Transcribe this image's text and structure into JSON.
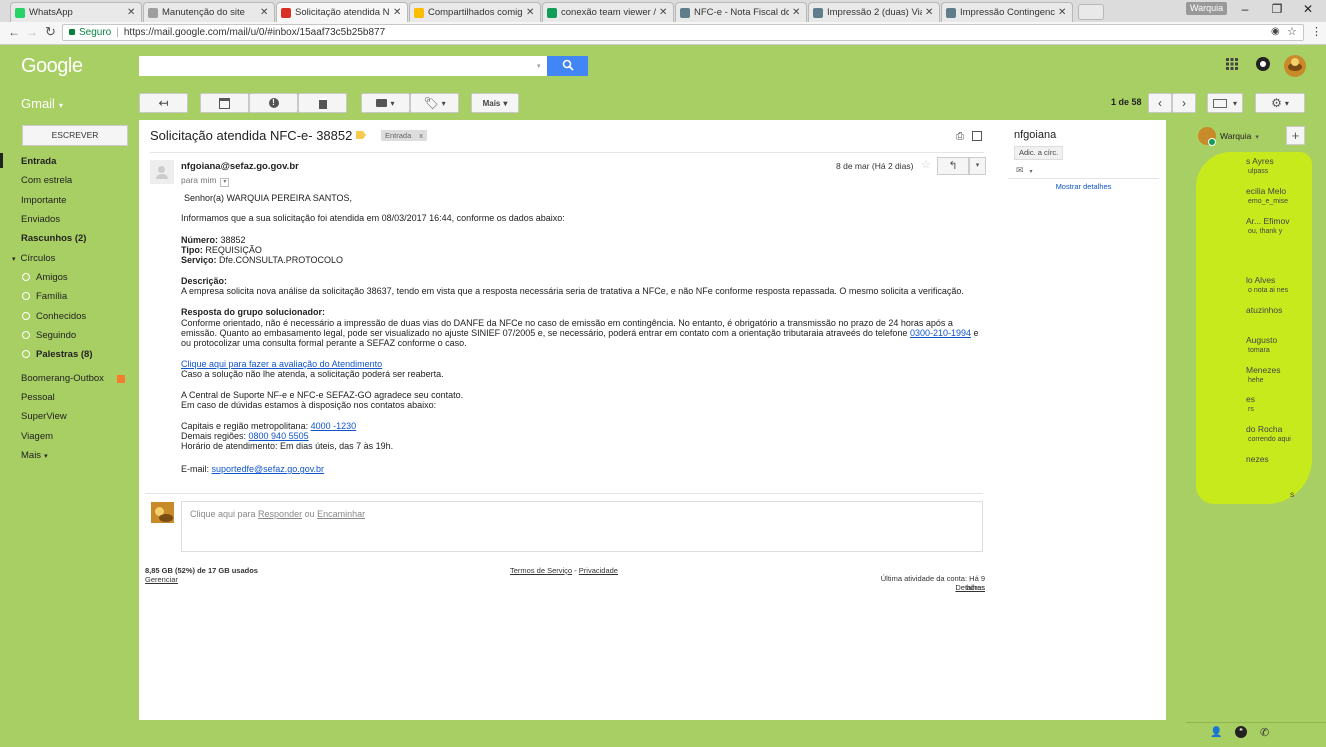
{
  "browser": {
    "tabs": [
      {
        "title": "WhatsApp",
        "icon": "whatsapp-icon",
        "color": "#25d366"
      },
      {
        "title": "Manutenção do site",
        "icon": "page-icon",
        "color": "#9e9e9e"
      },
      {
        "title": "Solicitação atendida NFC",
        "icon": "gmail-icon",
        "color": "#d93025",
        "active": true
      },
      {
        "title": "Compartilhados comigo",
        "icon": "drive-icon",
        "color": "#fbbc04"
      },
      {
        "title": "conexão team viewer / c",
        "icon": "sheets-icon",
        "color": "#0f9d58"
      },
      {
        "title": "NFC-e - Nota Fiscal do C",
        "icon": "site-icon",
        "color": "#607d8b"
      },
      {
        "title": "Impressão 2 (duas) Vias",
        "icon": "site-icon",
        "color": "#607d8b"
      },
      {
        "title": "Impressão Contingencia",
        "icon": "site-icon",
        "color": "#607d8b"
      }
    ],
    "profile": "Warquia",
    "secure_label": "Seguro",
    "url": "https://mail.google.com/mail/u/0/#inbox/15aaf73c5b25b877"
  },
  "header": {
    "logo": "Google",
    "app_label": "Gmail",
    "pagination": "1 de 58",
    "more_label": "Mais"
  },
  "nav": {
    "compose_label": "ESCREVER",
    "items": [
      {
        "label": "Entrada",
        "bold": true
      },
      {
        "label": "Com estrela"
      },
      {
        "label": "Importante"
      },
      {
        "label": "Enviados"
      },
      {
        "label": "Rascunhos (2)",
        "bold": true
      },
      {
        "label": "Círculos"
      },
      {
        "label": "Amigos"
      },
      {
        "label": "Família"
      },
      {
        "label": "Conhecidos"
      },
      {
        "label": "Seguindo"
      },
      {
        "label": "Palestras (8)",
        "bold": true
      },
      {
        "label": "Boomerang-Outbox"
      },
      {
        "label": "Pessoal"
      },
      {
        "label": "SuperView"
      },
      {
        "label": "Viagem"
      },
      {
        "label": "Mais"
      }
    ]
  },
  "email": {
    "subject": "Solicitação atendida NFC-e- 38852",
    "label_chip": "Entrada",
    "label_chip_close": "x",
    "sender": "nfgoiana@sefaz.go.gov.br",
    "to": "para mim",
    "date": "8 de mar (Há 2 dias)",
    "greeting": "Senhor(a) WARQUIA PEREIRA SANTOS,",
    "intro": "Informamos que a sua solicitação foi atendida em 08/03/2017 16:44, conforme os dados abaixo:",
    "numero_label": "Número:",
    "numero_value": " 38852",
    "tipo_label": "Tipo:",
    "tipo_value": " REQUISIÇÃO",
    "servico_label": "Serviço:",
    "servico_value": " Dfe.CONSULTA.PROTOCOLO",
    "descricao_label": "Descrição:",
    "descricao_text": "A empresa solicita nova análise da solicitação 38637, tendo em vista que a resposta necessária seria de tratativa a NFCe, e não NFe conforme resposta repassada. O mesmo solicita a verificação.",
    "resposta_label": "Resposta do grupo solucionador:",
    "resposta_line1": "Conforme orientado, não é necessário a impressão de duas vias do DANFE da NFCe no caso de emissão em contingência. No entanto, é obrigatório a transmissão no prazo de 24 horas após a",
    "resposta_line2": "emissão. Quanto ao embasamento legal, pode ser visualizado no ajuste SINIEF 07/2005 e, se necessário, poderá entrar em contato com a orientação tributaraia atraveés do telefone ",
    "resposta_phone": "0300-210-1994",
    "resposta_line2_end": " e",
    "resposta_line3": "ou protocolizar uma consulta formal perante a SEFAZ conforme o caso.",
    "eval_link": "Clique aqui para fazer a avaliação do Atendimento",
    "reopen_text": "Caso a solução não lhe atenda, a solicitação poderá ser reaberta.",
    "thanks_line1": "A Central de Suporte NF-e e NFC-e SEFAZ-GO agradece seu contato.",
    "thanks_line2": "Em caso de dúvidas estamos à disposição nos contatos abaixo:",
    "capitais_label": "Capitais e região metropolitana: ",
    "capitais_phone": "4000 -1230",
    "demais_label": "Demais regiões: ",
    "demais_phone": "0800 940 5505",
    "horario": "Horário de atendimento: Em dias úteis, das 7 às 19h.",
    "email_label": "E-mail: ",
    "email_link": "suportedfe@sefaz.go.gov.br"
  },
  "reply": {
    "prefix": "Clique aqui para ",
    "reply_link": "Responder",
    "or": " ou ",
    "forward_link": "Encaminhar"
  },
  "footer": {
    "storage": "8,85 GB (52%) de 17 GB usados",
    "manage": "Gerenciar",
    "terms": "Termos de Serviço",
    "sep": " - ",
    "privacy": "Privacidade",
    "last_activity": "Última atividade da conta: Há 9 horas",
    "details": "Detalhes"
  },
  "sender_panel": {
    "name": "nfgoiana",
    "add_circle": "Adic. a círc.",
    "show_details": "Mostrar detalhes"
  },
  "chat": {
    "me": "Warquia",
    "contacts": [
      {
        "name": "s Ayres",
        "sub": "ulpass"
      },
      {
        "name": "ecilia Melo",
        "sub": "emo_e_mise"
      },
      {
        "name": "Ar... Efimov",
        "sub": "ou, thank y"
      },
      {
        "name": "lo Alves",
        "sub": "o nota ai nes"
      },
      {
        "name": "atuzinhos",
        "sub": ""
      },
      {
        "name": "Augusto",
        "sub": "tomara"
      },
      {
        "name": "Menezes",
        "sub": "hehe"
      },
      {
        "name": "es",
        "sub": "rs"
      },
      {
        "name": "do Rocha",
        "sub": "correndo aqui"
      },
      {
        "name": "nezes",
        "sub": ""
      },
      {
        "name": "s",
        "sub": ""
      }
    ]
  },
  "colors": {
    "theme_green": "#a8cf63",
    "link_blue": "#1155cc",
    "search_blue": "#4285f4",
    "boomerang_orange": "#f57c31",
    "contacts_overlay": "#c7ea1d"
  }
}
